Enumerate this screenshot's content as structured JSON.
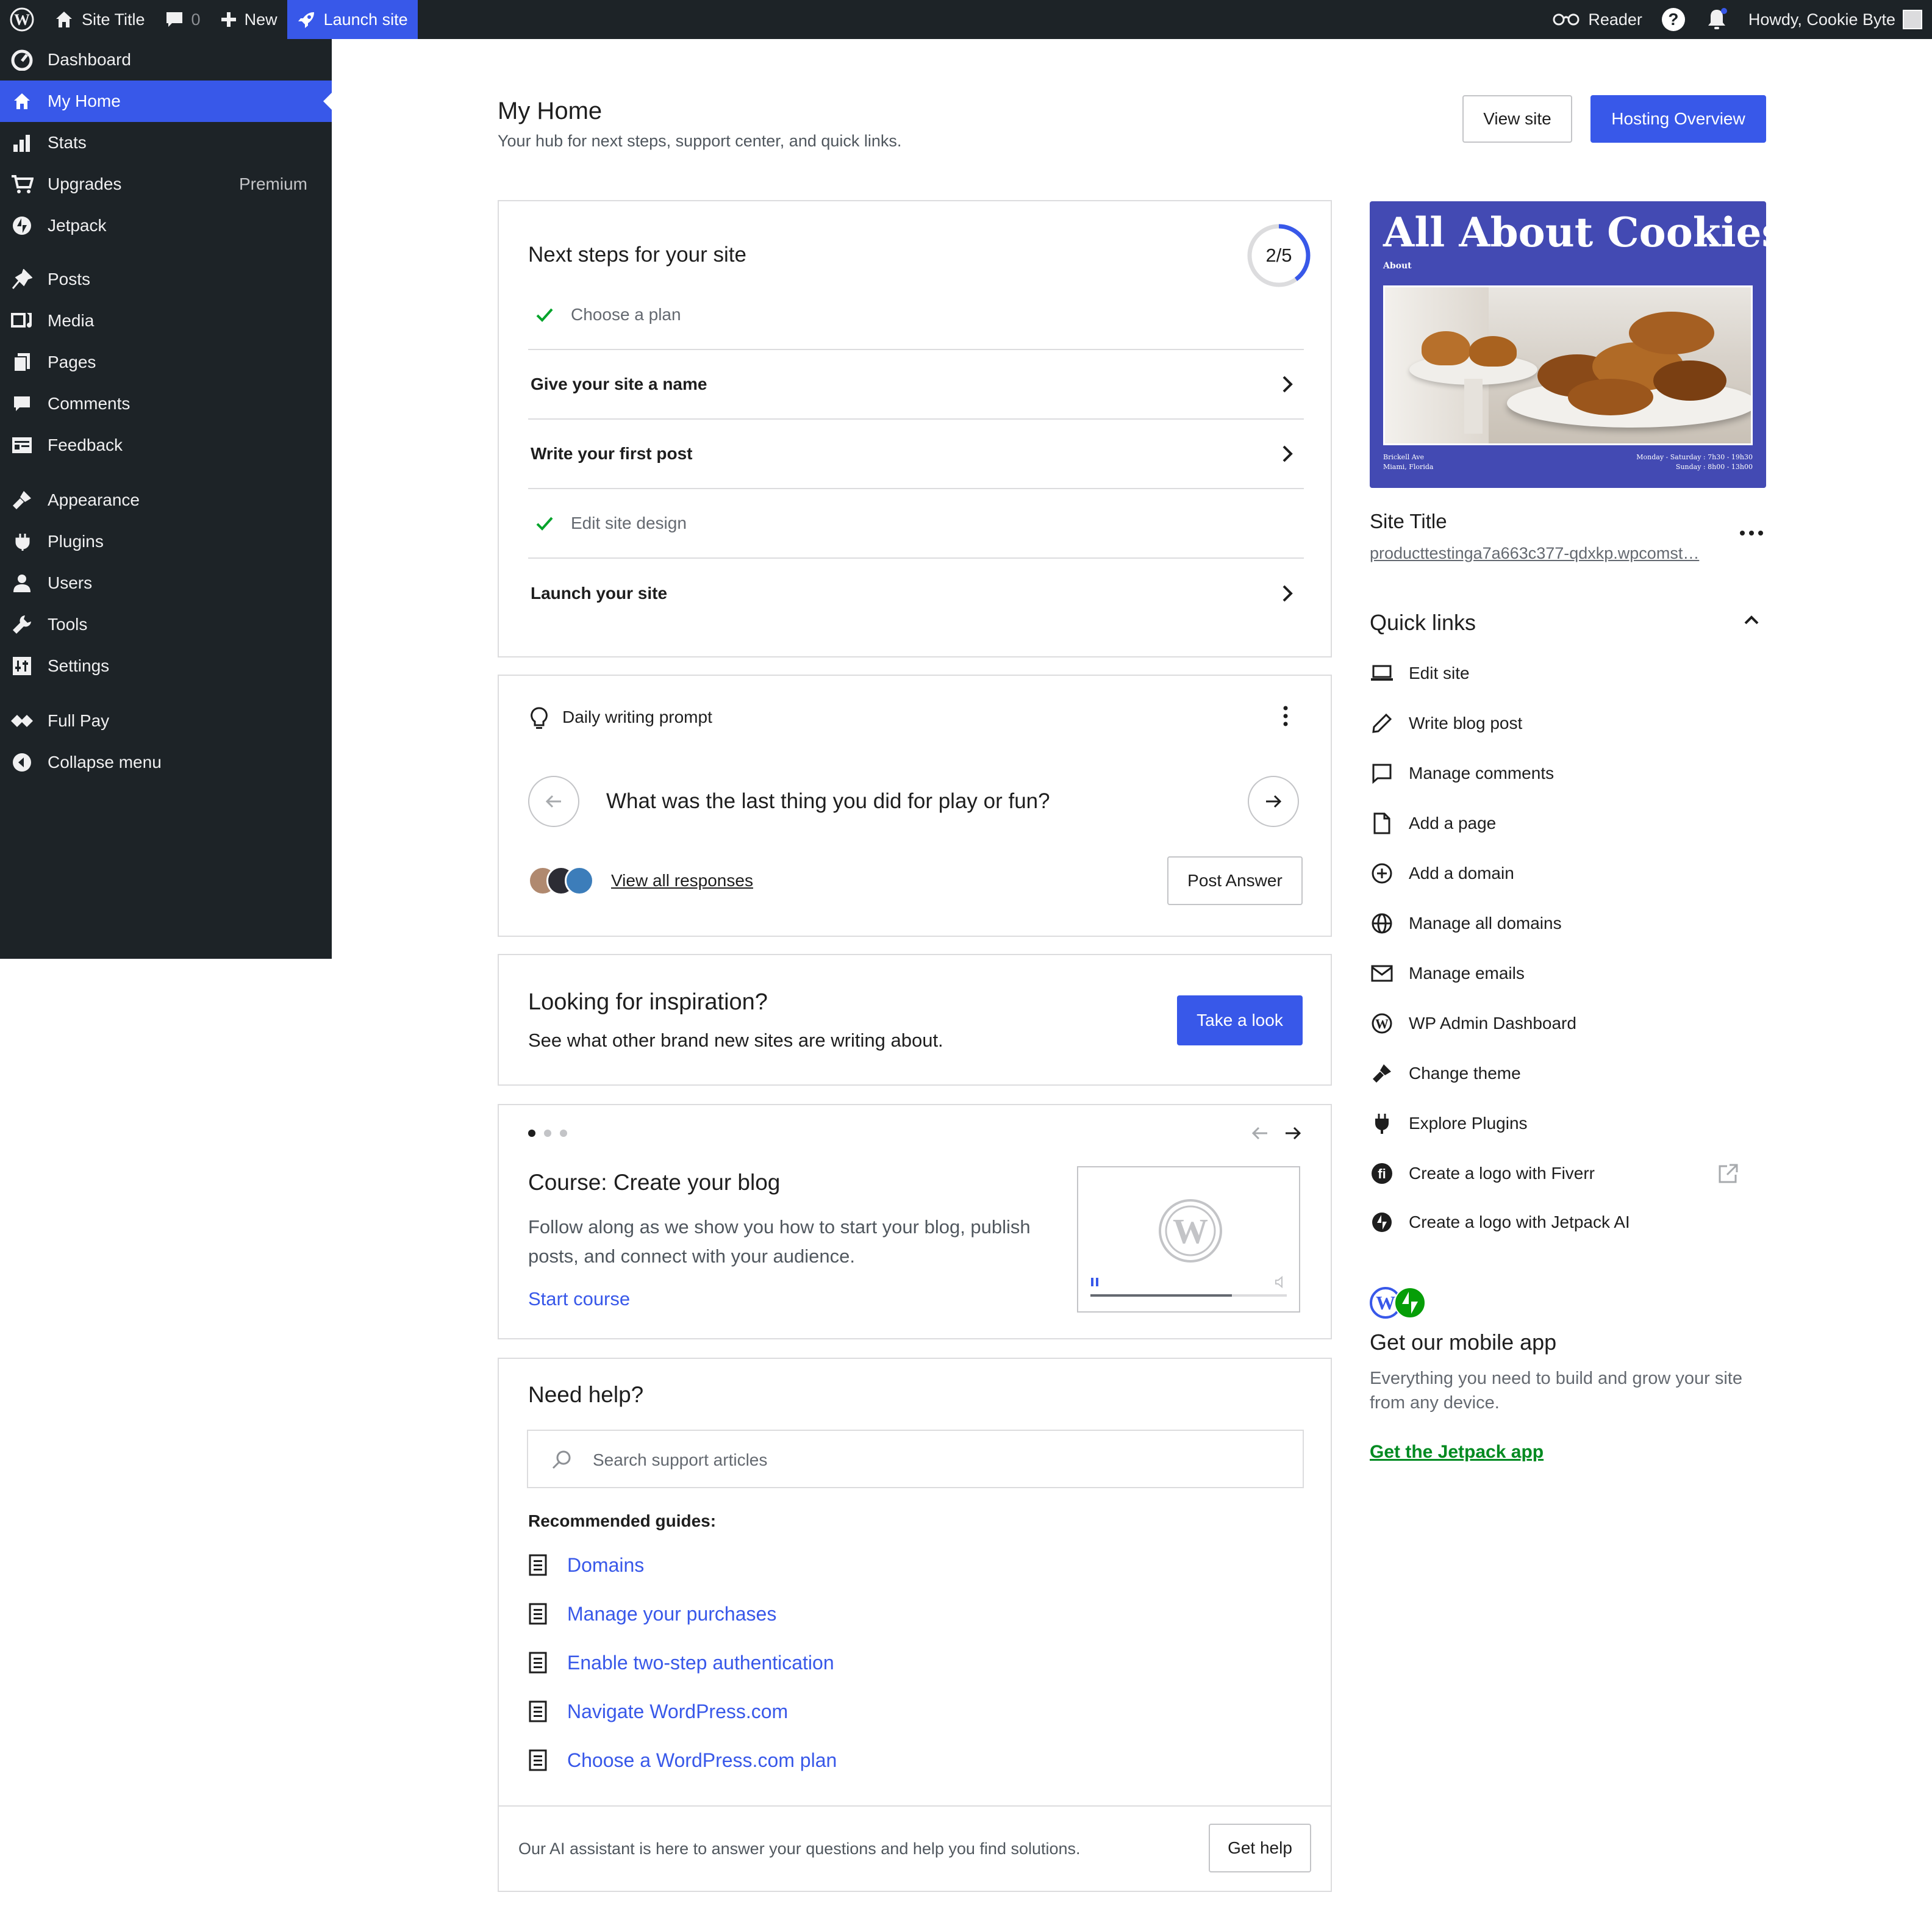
{
  "adminbar": {
    "site_title": "Site Title",
    "comments_count": "0",
    "new_label": "New",
    "launch_label": "Launch site",
    "reader_label": "Reader",
    "howdy": "Howdy, Cookie Byte"
  },
  "sidebar": {
    "items": [
      {
        "label": "Dashboard",
        "icon": "dashboard-icon"
      },
      {
        "label": "My Home",
        "icon": "home-icon",
        "active": true
      },
      {
        "label": "Stats",
        "icon": "stats-icon"
      },
      {
        "label": "Upgrades",
        "icon": "cart-icon",
        "badge": "Premium"
      },
      {
        "label": "Jetpack",
        "icon": "jetpack-icon"
      },
      {
        "label": "Posts",
        "icon": "pin-icon"
      },
      {
        "label": "Media",
        "icon": "media-icon"
      },
      {
        "label": "Pages",
        "icon": "pages-icon"
      },
      {
        "label": "Comments",
        "icon": "comment-icon"
      },
      {
        "label": "Feedback",
        "icon": "feedback-icon"
      },
      {
        "label": "Appearance",
        "icon": "brush-icon"
      },
      {
        "label": "Plugins",
        "icon": "plugin-icon"
      },
      {
        "label": "Users",
        "icon": "user-icon"
      },
      {
        "label": "Tools",
        "icon": "wrench-icon"
      },
      {
        "label": "Settings",
        "icon": "settings-icon"
      },
      {
        "label": "Full Pay",
        "icon": "fullpay-icon"
      },
      {
        "label": "Collapse menu",
        "icon": "collapse-icon"
      }
    ]
  },
  "header": {
    "title": "My Home",
    "subtitle": "Your hub for next steps, support center, and quick links.",
    "view_site": "View site",
    "hosting_overview": "Hosting Overview"
  },
  "next_steps": {
    "title": "Next steps for your site",
    "progress_text": "2/5",
    "progress_fraction": 0.4,
    "tasks": [
      {
        "label": "Choose a plan",
        "done": true
      },
      {
        "label": "Give your site a name",
        "done": false
      },
      {
        "label": "Write your first post",
        "done": false
      },
      {
        "label": "Edit site design",
        "done": true
      },
      {
        "label": "Launch your site",
        "done": false
      }
    ]
  },
  "prompt": {
    "header": "Daily writing prompt",
    "question": "What was the last thing you did for play or fun?",
    "view_responses": "View all responses",
    "post_answer": "Post Answer"
  },
  "inspiration": {
    "title": "Looking for inspiration?",
    "text": "See what other brand new sites are writing about.",
    "button": "Take a look"
  },
  "course": {
    "title": "Course: Create your blog",
    "text_line1": "Follow along as we show you how to start your blog, publish",
    "text_line2": "posts, and connect with your audience.",
    "link": "Start course",
    "video_progress": 0.72
  },
  "help": {
    "title": "Need help?",
    "search_placeholder": "Search support articles",
    "guides_heading": "Recommended guides:",
    "guides": [
      "Domains",
      "Manage your purchases",
      "Enable two-step authentication",
      "Navigate WordPress.com",
      "Choose a WordPress.com plan"
    ],
    "footer_text": "Our AI assistant is here to answer your questions and help you find solutions.",
    "get_help": "Get help"
  },
  "site_preview": {
    "hero_title": "All About Cookies",
    "nav_label": "About",
    "address_line1": "Brickell Ave",
    "address_line2": "Miami, Florida",
    "hours_line1": "Monday - Saturday : 7h30 - 19h30",
    "hours_line2": "Sunday : 8h00 - 13h00",
    "site_title": "Site Title",
    "site_url": "producttestinga7a663c377-qdxkp.wpcomst…",
    "bg_color": "#434ab3"
  },
  "quick_links": {
    "title": "Quick links",
    "items": [
      {
        "label": "Edit site",
        "icon": "laptop-icon"
      },
      {
        "label": "Write blog post",
        "icon": "pencil-icon"
      },
      {
        "label": "Manage comments",
        "icon": "comment-outline-icon"
      },
      {
        "label": "Add a page",
        "icon": "page-icon"
      },
      {
        "label": "Add a domain",
        "icon": "plus-circle-icon"
      },
      {
        "label": "Manage all domains",
        "icon": "globe-icon"
      },
      {
        "label": "Manage emails",
        "icon": "mail-icon"
      },
      {
        "label": "WP Admin Dashboard",
        "icon": "wordpress-icon"
      },
      {
        "label": "Change theme",
        "icon": "brush-icon"
      },
      {
        "label": "Explore Plugins",
        "icon": "plug-icon"
      },
      {
        "label": "Create a logo with Fiverr",
        "icon": "fiverr-icon",
        "external": true
      },
      {
        "label": "Create a logo with Jetpack AI",
        "icon": "jetpack-icon"
      }
    ]
  },
  "mobile_app": {
    "title": "Get our mobile app",
    "text_line1": "Everything you need to build and grow your site",
    "text_line2": "from any device.",
    "link": "Get the Jetpack app"
  },
  "colors": {
    "accent": "#3858e9",
    "admin_bg": "#1d2327",
    "success": "#00a32a",
    "jetpack": "#069e08"
  }
}
